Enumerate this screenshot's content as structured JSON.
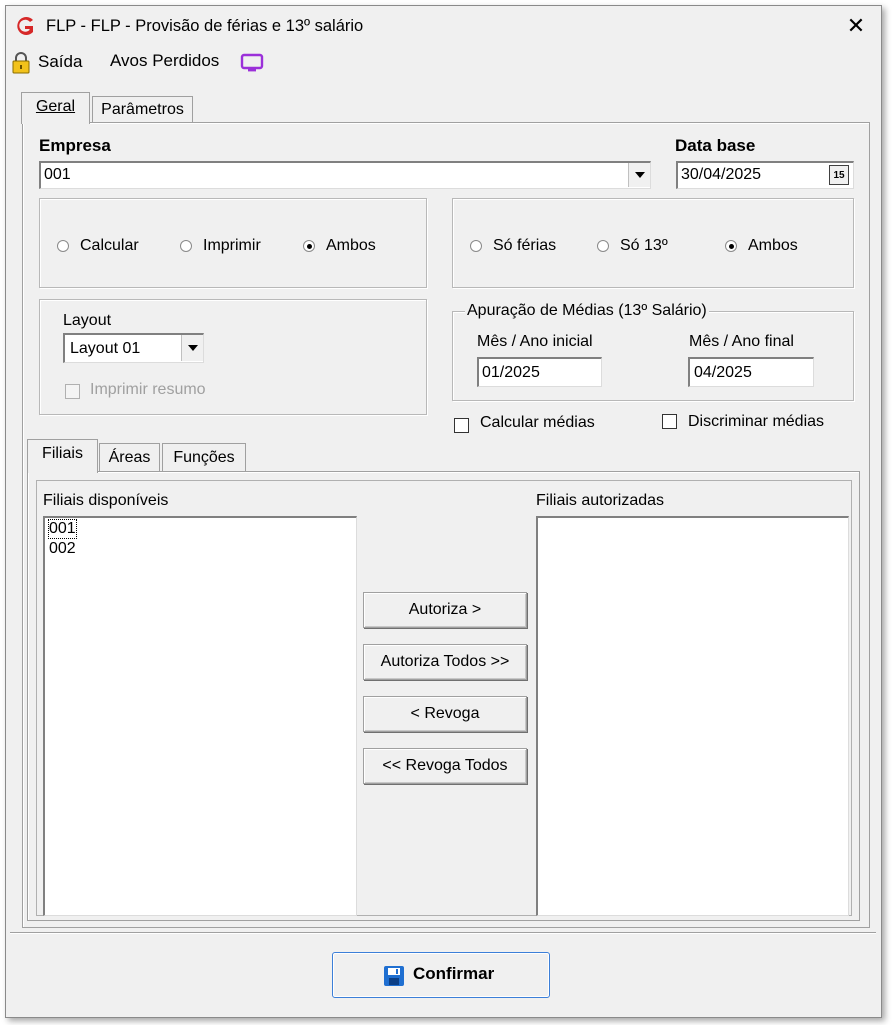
{
  "window": {
    "title": "FLP -  FLP - Provisão de férias e 13º salário",
    "close_glyph": "✕"
  },
  "menu": {
    "exit_label": "Saída",
    "lost_periods_label": "Avos Perdidos"
  },
  "main_tabs": [
    {
      "label": "Geral",
      "active": true
    },
    {
      "label": "Parâmetros",
      "active": false
    }
  ],
  "empresa": {
    "label": "Empresa",
    "value": "001"
  },
  "data_base": {
    "label": "Data base",
    "value": "30/04/2025",
    "calendar_glyph": "15"
  },
  "action_group": {
    "options": [
      "Calcular",
      "Imprimir",
      "Ambos"
    ],
    "selected": "Ambos"
  },
  "scope_group": {
    "options": [
      "Só férias",
      "Só 13º",
      "Ambos"
    ],
    "selected": "Ambos"
  },
  "layout": {
    "label": "Layout",
    "value": "Layout 01",
    "print_summary_label": "Imprimir resumo",
    "print_summary_checked": false,
    "print_summary_enabled": false
  },
  "averages": {
    "legend": "Apuração de Médias (13º Salário)",
    "initial_label": "Mês / Ano inicial",
    "initial_value": "01/2025",
    "final_label": "Mês / Ano final",
    "final_value": "04/2025",
    "calc_averages_label": "Calcular médias",
    "calc_averages_checked": false,
    "detail_averages_label": "Discriminar médias",
    "detail_averages_checked": false
  },
  "sub_tabs": [
    {
      "label": "Filiais",
      "active": true
    },
    {
      "label": "Áreas",
      "active": false
    },
    {
      "label": "Funções",
      "active": false
    }
  ],
  "branches": {
    "available_label": "Filiais disponíveis",
    "available_items": [
      "001",
      "002"
    ],
    "authorized_label": "Filiais autorizadas",
    "authorized_items": []
  },
  "transfer_buttons": {
    "authorize": "Autoriza >",
    "authorize_all": "Autoriza Todos >>",
    "revoke": "< Revoga",
    "revoke_all": "<< Revoga Todos"
  },
  "confirm_label": "Confirmar",
  "colors": {
    "app_icon": "#d62828",
    "monitor_icon": "#9b30d9",
    "save_icon": "#1f6fd1",
    "window_bg": "#f0f0f0"
  }
}
